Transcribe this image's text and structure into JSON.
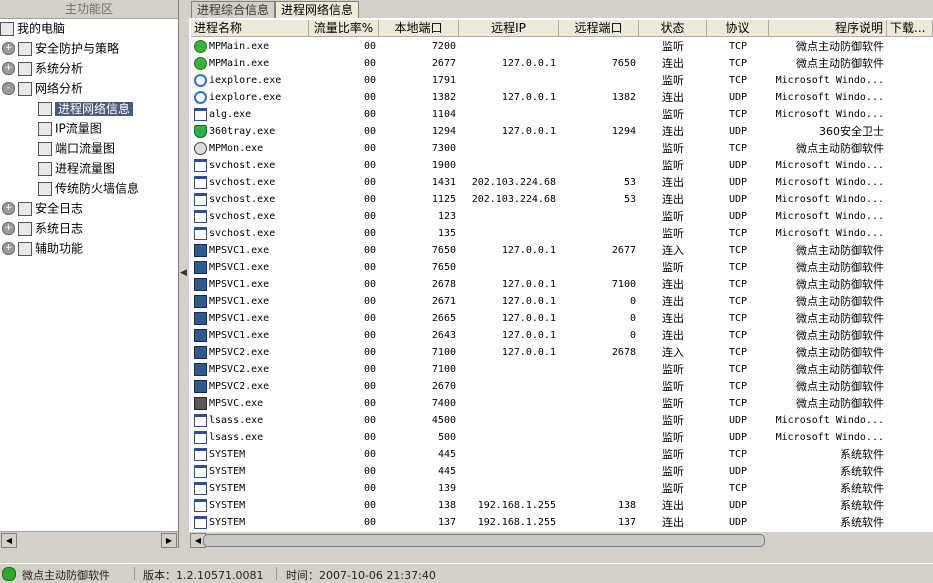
{
  "left_panel": {
    "title": "主功能区",
    "tree": [
      {
        "label": "我的电脑",
        "level": 0,
        "icon": "computer-icon",
        "expander": ""
      },
      {
        "label": "安全防护与策略",
        "level": 1,
        "icon": "policy-icon",
        "expander": "+"
      },
      {
        "label": "系统分析",
        "level": 1,
        "icon": "system-analysis-icon",
        "expander": "+"
      },
      {
        "label": "网络分析",
        "level": 1,
        "icon": "network-analysis-icon",
        "expander": "-"
      },
      {
        "label": "进程网络信息",
        "level": 2,
        "icon": "process-network-icon",
        "expander": "",
        "selected": true
      },
      {
        "label": "IP流量图",
        "level": 2,
        "icon": "ip-traffic-icon",
        "expander": ""
      },
      {
        "label": "端口流量图",
        "level": 2,
        "icon": "port-traffic-icon",
        "expander": ""
      },
      {
        "label": "进程流量图",
        "level": 2,
        "icon": "process-traffic-icon",
        "expander": ""
      },
      {
        "label": "传统防火墙信息",
        "level": 2,
        "icon": "firewall-icon",
        "expander": ""
      },
      {
        "label": "安全日志",
        "level": 1,
        "icon": "security-log-icon",
        "expander": "+"
      },
      {
        "label": "系统日志",
        "level": 1,
        "icon": "system-log-icon",
        "expander": "+"
      },
      {
        "label": "辅助功能",
        "level": 1,
        "icon": "tools-icon",
        "expander": "+"
      }
    ]
  },
  "tabs": [
    {
      "label": "进程综合信息",
      "active": false
    },
    {
      "label": "进程网络信息",
      "active": true
    }
  ],
  "columns": [
    "进程名称",
    "流量比率%",
    "本地端口",
    "远程IP",
    "远程端口",
    "状态",
    "协议",
    "程序说明",
    "下载..."
  ],
  "rows": [
    {
      "icon": "green",
      "name": "MPMain.exe",
      "ratio": "00",
      "lport": "7200",
      "rip": "",
      "rport": "",
      "state": "监听",
      "proto": "TCP",
      "desc": "微点主动防御软件"
    },
    {
      "icon": "green",
      "name": "MPMain.exe",
      "ratio": "00",
      "lport": "2677",
      "rip": "127.0.0.1",
      "rport": "7650",
      "state": "连出",
      "proto": "TCP",
      "desc": "微点主动防御软件"
    },
    {
      "icon": "ie",
      "name": "iexplore.exe",
      "ratio": "00",
      "lport": "1791",
      "rip": "",
      "rport": "",
      "state": "监听",
      "proto": "TCP",
      "desc": "Microsoft Windo..."
    },
    {
      "icon": "ie",
      "name": "iexplore.exe",
      "ratio": "00",
      "lport": "1382",
      "rip": "127.0.0.1",
      "rport": "1382",
      "state": "连出",
      "proto": "UDP",
      "desc": "Microsoft Windo..."
    },
    {
      "icon": "win",
      "name": "alg.exe",
      "ratio": "00",
      "lport": "1104",
      "rip": "",
      "rport": "",
      "state": "监听",
      "proto": "TCP",
      "desc": "Microsoft Windo..."
    },
    {
      "icon": "shield",
      "name": "360tray.exe",
      "ratio": "00",
      "lport": "1294",
      "rip": "127.0.0.1",
      "rport": "1294",
      "state": "连出",
      "proto": "UDP",
      "desc": "360安全卫士"
    },
    {
      "icon": "mon",
      "name": "MPMon.exe",
      "ratio": "00",
      "lport": "7300",
      "rip": "",
      "rport": "",
      "state": "监听",
      "proto": "TCP",
      "desc": "微点主动防御软件"
    },
    {
      "icon": "win",
      "name": "svchost.exe",
      "ratio": "00",
      "lport": "1900",
      "rip": "",
      "rport": "",
      "state": "监听",
      "proto": "UDP",
      "desc": "Microsoft Windo..."
    },
    {
      "icon": "win",
      "name": "svchost.exe",
      "ratio": "00",
      "lport": "1431",
      "rip": "202.103.224.68",
      "rport": "53",
      "state": "连出",
      "proto": "UDP",
      "desc": "Microsoft Windo..."
    },
    {
      "icon": "win",
      "name": "svchost.exe",
      "ratio": "00",
      "lport": "1125",
      "rip": "202.103.224.68",
      "rport": "53",
      "state": "连出",
      "proto": "UDP",
      "desc": "Microsoft Windo..."
    },
    {
      "icon": "win",
      "name": "svchost.exe",
      "ratio": "00",
      "lport": "123",
      "rip": "",
      "rport": "",
      "state": "监听",
      "proto": "UDP",
      "desc": "Microsoft Windo..."
    },
    {
      "icon": "win",
      "name": "svchost.exe",
      "ratio": "00",
      "lport": "135",
      "rip": "",
      "rport": "",
      "state": "监听",
      "proto": "TCP",
      "desc": "Microsoft Windo..."
    },
    {
      "icon": "blue",
      "name": "MPSVC1.exe",
      "ratio": "00",
      "lport": "7650",
      "rip": "127.0.0.1",
      "rport": "2677",
      "state": "连入",
      "proto": "TCP",
      "desc": "微点主动防御软件"
    },
    {
      "icon": "blue",
      "name": "MPSVC1.exe",
      "ratio": "00",
      "lport": "7650",
      "rip": "",
      "rport": "",
      "state": "监听",
      "proto": "TCP",
      "desc": "微点主动防御软件"
    },
    {
      "icon": "blue",
      "name": "MPSVC1.exe",
      "ratio": "00",
      "lport": "2678",
      "rip": "127.0.0.1",
      "rport": "7100",
      "state": "连出",
      "proto": "TCP",
      "desc": "微点主动防御软件"
    },
    {
      "icon": "blue",
      "name": "MPSVC1.exe",
      "ratio": "00",
      "lport": "2671",
      "rip": "127.0.0.1",
      "rport": "0",
      "state": "连出",
      "proto": "TCP",
      "desc": "微点主动防御软件"
    },
    {
      "icon": "blue",
      "name": "MPSVC1.exe",
      "ratio": "00",
      "lport": "2665",
      "rip": "127.0.0.1",
      "rport": "0",
      "state": "连出",
      "proto": "TCP",
      "desc": "微点主动防御软件"
    },
    {
      "icon": "blue",
      "name": "MPSVC1.exe",
      "ratio": "00",
      "lport": "2643",
      "rip": "127.0.0.1",
      "rport": "0",
      "state": "连出",
      "proto": "TCP",
      "desc": "微点主动防御软件"
    },
    {
      "icon": "blue",
      "name": "MPSVC2.exe",
      "ratio": "00",
      "lport": "7100",
      "rip": "127.0.0.1",
      "rport": "2678",
      "state": "连入",
      "proto": "TCP",
      "desc": "微点主动防御软件"
    },
    {
      "icon": "blue",
      "name": "MPSVC2.exe",
      "ratio": "00",
      "lport": "7100",
      "rip": "",
      "rport": "",
      "state": "监听",
      "proto": "TCP",
      "desc": "微点主动防御软件"
    },
    {
      "icon": "blue",
      "name": "MPSVC2.exe",
      "ratio": "00",
      "lport": "2670",
      "rip": "",
      "rport": "",
      "state": "监听",
      "proto": "TCP",
      "desc": "微点主动防御软件"
    },
    {
      "icon": "dark",
      "name": "MPSVC.exe",
      "ratio": "00",
      "lport": "7400",
      "rip": "",
      "rport": "",
      "state": "监听",
      "proto": "TCP",
      "desc": "微点主动防御软件"
    },
    {
      "icon": "win",
      "name": "lsass.exe",
      "ratio": "00",
      "lport": "4500",
      "rip": "",
      "rport": "",
      "state": "监听",
      "proto": "UDP",
      "desc": "Microsoft Windo..."
    },
    {
      "icon": "win",
      "name": "lsass.exe",
      "ratio": "00",
      "lport": "500",
      "rip": "",
      "rport": "",
      "state": "监听",
      "proto": "UDP",
      "desc": "Microsoft Windo..."
    },
    {
      "icon": "win",
      "name": "SYSTEM",
      "ratio": "00",
      "lport": "445",
      "rip": "",
      "rport": "",
      "state": "监听",
      "proto": "TCP",
      "desc": "系统软件"
    },
    {
      "icon": "win",
      "name": "SYSTEM",
      "ratio": "00",
      "lport": "445",
      "rip": "",
      "rport": "",
      "state": "监听",
      "proto": "UDP",
      "desc": "系统软件"
    },
    {
      "icon": "win",
      "name": "SYSTEM",
      "ratio": "00",
      "lport": "139",
      "rip": "",
      "rport": "",
      "state": "监听",
      "proto": "TCP",
      "desc": "系统软件"
    },
    {
      "icon": "win",
      "name": "SYSTEM",
      "ratio": "00",
      "lport": "138",
      "rip": "192.168.1.255",
      "rport": "138",
      "state": "连出",
      "proto": "UDP",
      "desc": "系统软件"
    },
    {
      "icon": "win",
      "name": "SYSTEM",
      "ratio": "00",
      "lport": "137",
      "rip": "192.168.1.255",
      "rport": "137",
      "state": "连出",
      "proto": "UDP",
      "desc": "系统软件"
    }
  ],
  "status_bar": {
    "app": "微点主动防御软件",
    "version": "版本：1.2.10571.0081",
    "time": "时间：2007-10-06 21:37:40"
  }
}
